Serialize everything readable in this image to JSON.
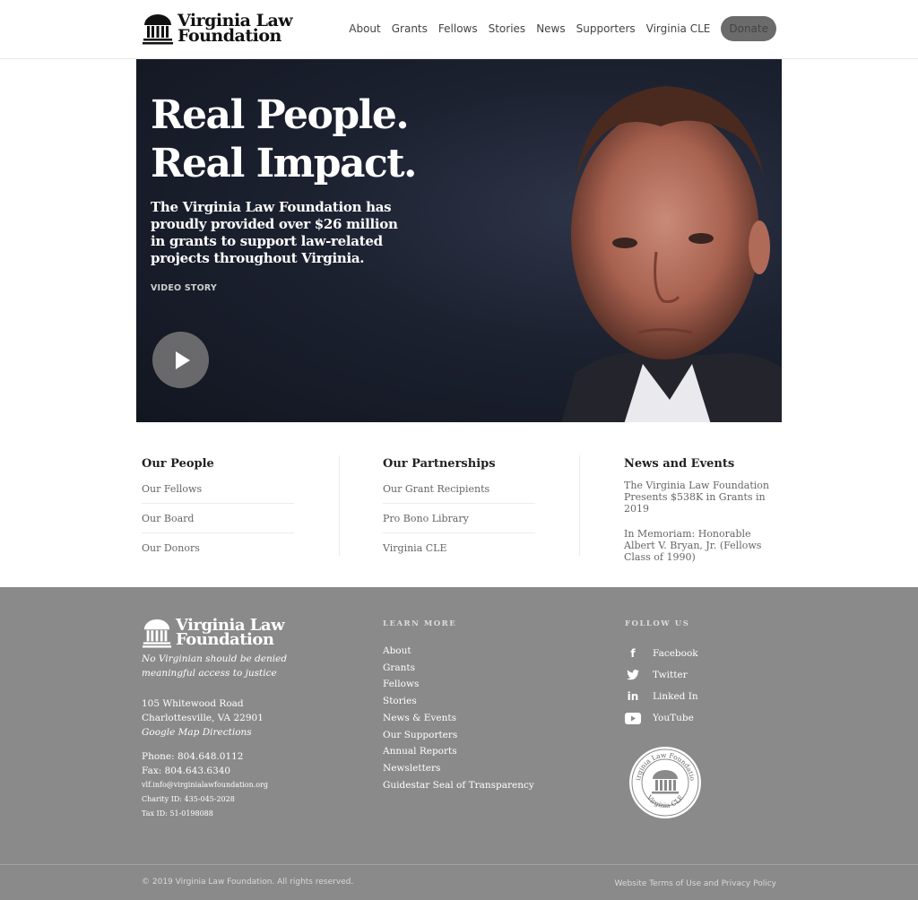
{
  "header": {
    "logo_line1": "Virginia Law",
    "logo_line2": "Foundation",
    "nav": [
      "About",
      "Grants",
      "Fellows",
      "Stories",
      "News",
      "Supporters",
      "Virginia CLE"
    ],
    "donate_label": "Donate"
  },
  "hero": {
    "title_line1": "Real People.",
    "title_line2": "Real Impact.",
    "subtitle": "The Virginia Law Foundation has proudly provided over $26 million in grants to support law-related projects throughout Virginia.",
    "tag": "VIDEO STORY",
    "play_icon": "play-icon"
  },
  "sections": {
    "people": {
      "heading": "Our People",
      "links": [
        "Our Fellows",
        "Our Board",
        "Our Donors"
      ]
    },
    "partnerships": {
      "heading": "Our Partnerships",
      "links": [
        "Our Grant Recipients",
        "Pro Bono Library",
        "Virginia CLE"
      ]
    },
    "news": {
      "heading": "News and Events",
      "items": [
        "The Virginia Law Foundation Presents $538K in Grants in 2019",
        "In Memoriam: Honorable Albert V. Bryan, Jr. (Fellows Class of 1990)"
      ]
    }
  },
  "footer": {
    "logo_line1": "Virginia Law",
    "logo_line2": "Foundation",
    "tagline": "No Virginian should be denied meaningful access to justice",
    "address_line1": "105 Whitewood Road",
    "address_line2": "Charlottesville, VA 22901",
    "map_link": "Google Map Directions",
    "phone": "Phone: 804.648.0112",
    "fax": "Fax: 804.643.6340",
    "email": "vlf.info@virginialawfoundation.org",
    "charity_id": "Charity ID: 435-045-2028",
    "tax_id": "Tax ID: 51-0198088",
    "learn_more_heading": "LEARN MORE",
    "learn_more": [
      "About",
      "Grants",
      "Fellows",
      "Stories",
      "News & Events",
      "Our Supporters",
      "Annual Reports",
      "Newsletters",
      "Guidestar Seal of Transparency"
    ],
    "follow_heading": "FOLLOW US",
    "social": [
      {
        "label": "Facebook",
        "icon": "facebook-icon"
      },
      {
        "label": "Twitter",
        "icon": "twitter-icon"
      },
      {
        "label": "Linked In",
        "icon": "linkedin-icon"
      },
      {
        "label": "YouTube",
        "icon": "youtube-icon"
      }
    ],
    "seal_top": "Virginia Law Foundation",
    "seal_bottom": "Virginia CLE",
    "copyright": "© 2019 Virginia Law Foundation. All rights reserved.",
    "terms": "Website Terms of Use and Privacy Policy"
  },
  "colors": {
    "footer_bg": "#8a8a8a",
    "donate_bg": "#6b6b6b",
    "hero_bg": "#1c2130"
  }
}
